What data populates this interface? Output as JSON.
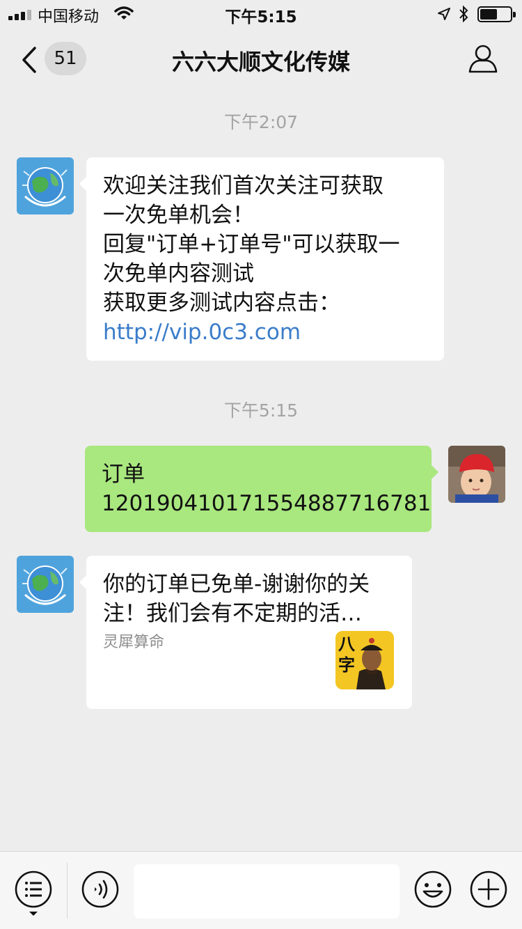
{
  "status_bar": {
    "carrier": "中国移动",
    "time": "下午5:15",
    "icons": [
      "signal-icon",
      "wifi-icon",
      "location-icon",
      "bluetooth-icon",
      "battery-icon"
    ],
    "battery_level": 0.5
  },
  "nav": {
    "title": "六六大顺文化传媒",
    "unread_count": "51",
    "back_icon": "chevron-left-icon",
    "profile_icon": "person-icon"
  },
  "messages": [
    {
      "timestamp": "下午2:07",
      "side": "left",
      "lines": [
        "欢迎关注我们首次关注可获取",
        "一次免单机会！",
        "回复\"订单+订单号\"可以获取一",
        "次免单内容测试",
        "获取更多测试内容点击："
      ],
      "link": "http://vip.0c3.com"
    },
    {
      "timestamp": "下午5:15",
      "side": "right",
      "lines": [
        "订单",
        "120190410171554887716781"
      ]
    },
    {
      "side": "left",
      "type": "card",
      "lines": [
        "你的订单已免单-谢谢你的关",
        "注！我们会有不定期的活…"
      ],
      "source": "灵犀算命",
      "thumbnail_text": "八字"
    }
  ],
  "toolbar": {
    "icons": [
      "menu-icon",
      "voice-icon",
      "emoji-icon",
      "plus-icon"
    ],
    "input_value": ""
  },
  "colors": {
    "background": "#ededed",
    "sent_bubble": "#a9e77f",
    "received_bubble": "#ffffff",
    "link": "#3a7cc9",
    "timestamp": "#a3a3a3"
  }
}
